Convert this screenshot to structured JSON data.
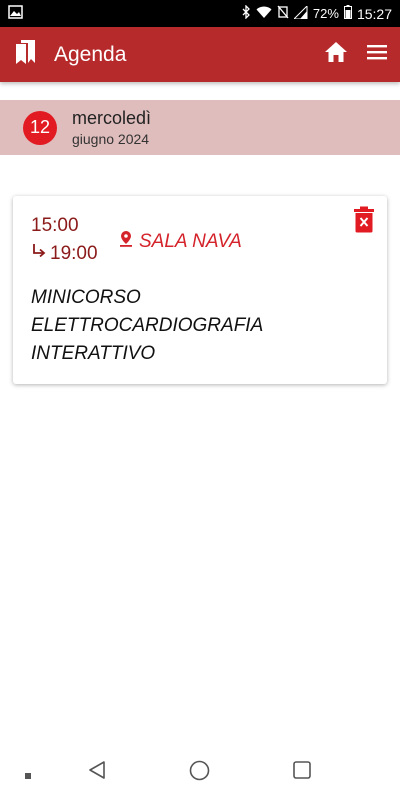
{
  "status_bar": {
    "battery": "72%",
    "time": "15:27"
  },
  "app_bar": {
    "title": "Agenda",
    "icons": [
      "bookmarks-icon",
      "home-icon",
      "menu-icon"
    ]
  },
  "date_header": {
    "day": "12",
    "weekday": "mercoledì",
    "month_year": "giugno 2024"
  },
  "event": {
    "start_time": "15:00",
    "end_time": "19:00",
    "location": "SALA NAVA",
    "title_lines": [
      "MINICORSO",
      "ELETTROCARDIOGRAFIA",
      "INTERATTIVO"
    ]
  },
  "colors": {
    "primary": "#b72a2c",
    "accent": "#e21b22",
    "date_header_bg": "#dfbdbc",
    "time_text": "#8b1a1a",
    "location_text": "#d4232a"
  }
}
